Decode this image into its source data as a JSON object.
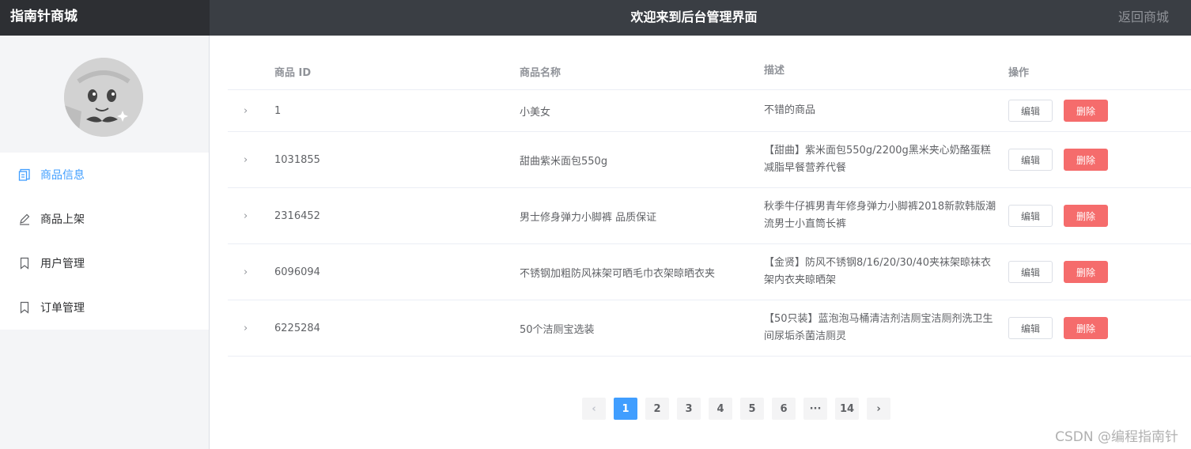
{
  "header": {
    "brand": "指南针商城",
    "title": "欢迎来到后台管理界面",
    "back_link": "返回商城"
  },
  "sidebar": {
    "items": [
      {
        "label": "商品信息",
        "icon": "document-icon",
        "active": true
      },
      {
        "label": "商品上架",
        "icon": "pencil-icon",
        "active": false
      },
      {
        "label": "用户管理",
        "icon": "bookmark-icon",
        "active": false
      },
      {
        "label": "订单管理",
        "icon": "bookmark-icon",
        "active": false
      }
    ]
  },
  "table": {
    "columns": [
      "商品 ID",
      "商品名称",
      "描述",
      "操作"
    ],
    "edit_label": "编辑",
    "delete_label": "删除",
    "rows": [
      {
        "id": "1",
        "name": "小美女",
        "desc": "不错的商品"
      },
      {
        "id": "1031855",
        "name": "甜曲紫米面包550g",
        "desc": "【甜曲】紫米面包550g/2200g黑米夹心奶酪蛋糕减脂早餐营养代餐"
      },
      {
        "id": "2316452",
        "name": "男士修身弹力小脚裤 品质保证",
        "desc": "秋季牛仔裤男青年修身弹力小脚裤2018新款韩版潮流男士小直筒长裤"
      },
      {
        "id": "6096094",
        "name": "不锈钢加粗防风袜架可晒毛巾衣架晾晒衣夹",
        "desc": "【金贤】防风不锈钢8/16/20/30/40夹袜架晾袜衣架内衣夹晾晒架"
      },
      {
        "id": "6225284",
        "name": "50个洁厕宝选装",
        "desc": "【50只装】蓝泡泡马桶清洁剂洁厕宝洁厕剂洗卫生间尿垢杀菌洁厕灵"
      }
    ]
  },
  "pagination": {
    "pages": [
      "1",
      "2",
      "3",
      "4",
      "5",
      "6",
      "···",
      "14"
    ],
    "current": "1"
  },
  "watermark": "CSDN @编程指南针"
}
